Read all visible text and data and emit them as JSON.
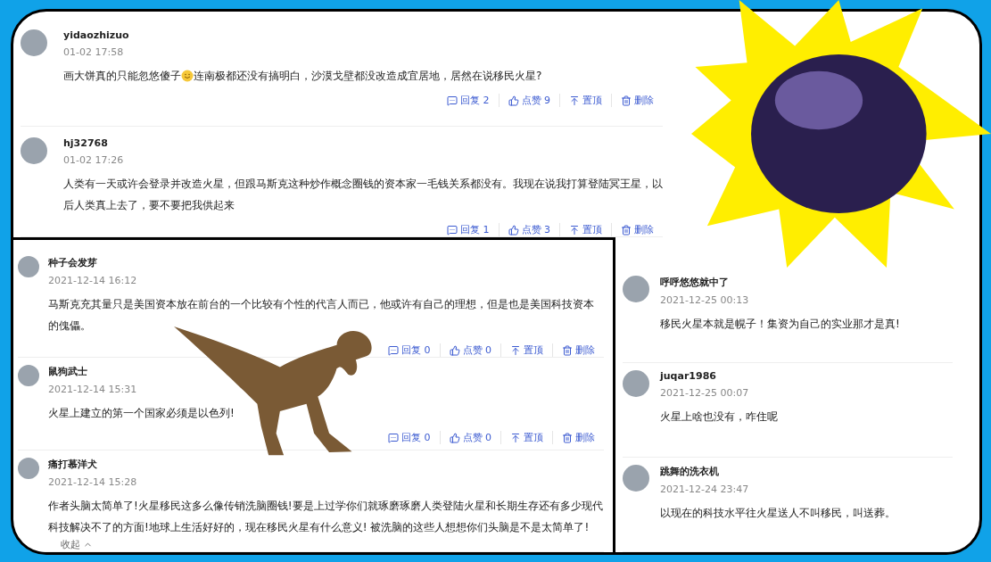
{
  "top_comments": [
    {
      "user": "yidaozhizuo",
      "time": "01-02 17:58",
      "text": [
        "画大饼真的只能忽悠傻子",
        "连南极都还没有搞明白，沙漠戈壁都没改造成宜居地，居然在说移民火星?"
      ],
      "actions": [
        {
          "kind": "reply",
          "label": "回复 2"
        },
        {
          "kind": "like",
          "label": "点赞 9"
        },
        {
          "kind": "pin",
          "label": "置顶"
        },
        {
          "kind": "delete",
          "label": "删除"
        }
      ]
    },
    {
      "user": "hj32768",
      "time": "01-02 17:26",
      "text": [
        "人类有一天或许会登录并改造火星，但跟马斯克这种炒作概念圈钱的资本家一毛钱关系都没有。我现在说我打算登陆冥王星，以后人类真上去了，要不要把我供起来"
      ],
      "actions": [
        {
          "kind": "reply",
          "label": "回复 1"
        },
        {
          "kind": "like",
          "label": "点赞 3"
        },
        {
          "kind": "pin",
          "label": "置顶"
        },
        {
          "kind": "delete",
          "label": "删除"
        }
      ]
    }
  ],
  "left_comments": [
    {
      "user": "种子会发芽",
      "time": "2021-12-14 16:12",
      "text": [
        "马斯克充其量只是美国资本放在前台的一个比较有个性的代言人而已，他或许有自己的理想，但是也是美国科技资本的傀儡。"
      ],
      "actions": [
        {
          "kind": "reply",
          "label": "回复 0"
        },
        {
          "kind": "like",
          "label": "点赞 0"
        },
        {
          "kind": "pin",
          "label": "置顶"
        },
        {
          "kind": "delete",
          "label": "删除"
        }
      ]
    },
    {
      "user": "鼠狗武士",
      "time": "2021-12-14 15:31",
      "text": [
        "火星上建立的第一个国家必须是以色列!"
      ],
      "actions": [
        {
          "kind": "reply",
          "label": "回复 0"
        },
        {
          "kind": "like",
          "label": "点赞 0"
        },
        {
          "kind": "pin",
          "label": "置顶"
        },
        {
          "kind": "delete",
          "label": "删除"
        }
      ]
    },
    {
      "user": "痛打慕洋犬",
      "time": "2021-12-14 15:28",
      "text": [
        "作者头脑太简单了!火星移民这多么像传销洗脑圈钱!要是上过学你们就琢磨琢磨人类登陆火星和长期生存还有多少现代科技解决不了的方面!地球上生活好好的，现在移民火星有什么意义! 被洗脑的这些人想想你们头脑是不是太简单了!"
      ],
      "fold": "收起"
    }
  ],
  "right_comments": [
    {
      "user": "呼呼悠悠就中了",
      "time": "2021-12-25 00:13",
      "text": [
        "移民火星本就是幌子！集资为自己的实业那才是真!"
      ]
    },
    {
      "user": "juqar1986",
      "time": "2021-12-25 00:07",
      "text": [
        "火星上啥也没有，咋住呢"
      ]
    },
    {
      "user": "跳舞的洗衣机",
      "time": "2021-12-24 23:47",
      "text": [
        "以现在的科技水平往火星送人不叫移民，叫送葬。"
      ]
    }
  ]
}
